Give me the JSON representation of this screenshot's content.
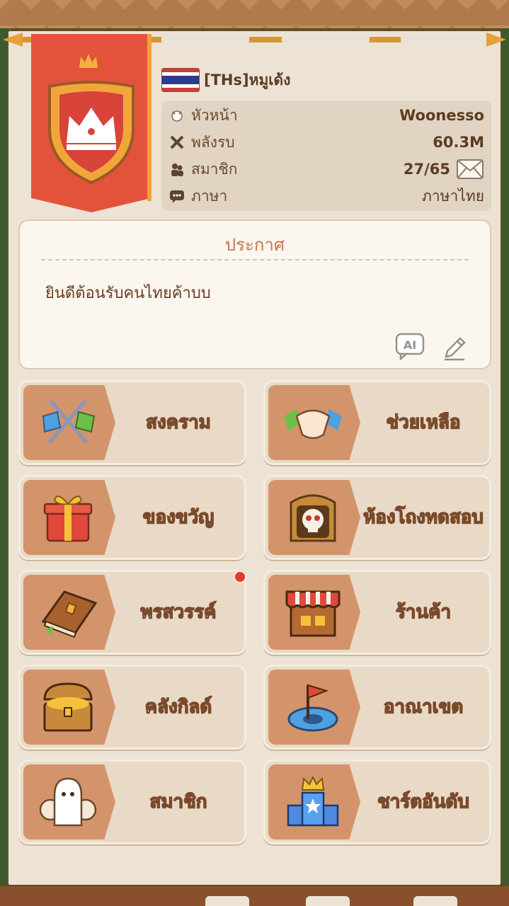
{
  "guild": {
    "name": "[THs]หมูเด้ง",
    "flag": "thailand-flag"
  },
  "info": {
    "leader_label": "หัวหน้า",
    "leader_value": "Woonesso",
    "power_label": "พลังรบ",
    "power_value": "60.3M",
    "members_label": "สมาชิก",
    "members_value": "27/65",
    "language_label": "ภาษา",
    "language_value": "ภาษาไทย"
  },
  "announcement": {
    "title": "ประกาศ",
    "text": "ยินดีต้อนรับคนไทยค้าบบ"
  },
  "menu": {
    "war": "สงคราม",
    "help": "ช่วยเหลือ",
    "gift": "ของขวัญ",
    "trial": "ห้องโถงทดสอบ",
    "blessing": "พรสวรรค์",
    "shop": "ร้านค้า",
    "storage": "คลังกิลด์",
    "territory": "อาณาเขต",
    "members": "สมาชิก",
    "ranking": "ชาร์ตอันดับ"
  },
  "colors": {
    "banner": "#e3533b",
    "accent": "#d3946c",
    "panel": "#ede3d4"
  }
}
